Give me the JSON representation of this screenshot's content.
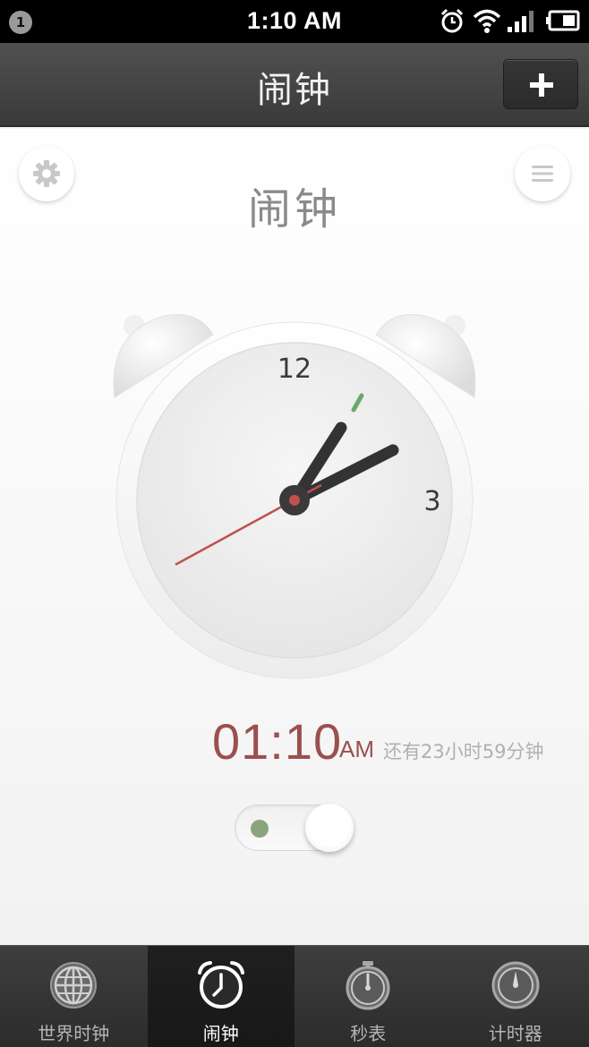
{
  "status_bar": {
    "notification_count": "1",
    "time": "1:10 AM",
    "icons": [
      "alarm-icon",
      "wifi-icon",
      "signal-icon",
      "battery-icon"
    ]
  },
  "header": {
    "title": "闹钟",
    "add_icon": "plus-icon"
  },
  "main": {
    "settings_icon": "gear-icon",
    "menu_icon": "menu-lines-icon",
    "alarm_label": "闹钟",
    "clock": {
      "numeral_12": "12",
      "numeral_3": "3"
    },
    "alarm_time": "01:10",
    "alarm_ampm": "AM",
    "remaining": "还有23小时59分钟",
    "toggle_on": true
  },
  "colors": {
    "accent_red": "#9b4f4f",
    "second_hand": "#c0504d",
    "alarm_marker": "#6aa86a",
    "toggle_dot": "#8aa57e"
  },
  "bottom_nav": {
    "items": [
      {
        "label": "世界时钟",
        "icon": "globe-icon",
        "active": false
      },
      {
        "label": "闹钟",
        "icon": "alarm-clock-icon",
        "active": true
      },
      {
        "label": "秒表",
        "icon": "stopwatch-icon",
        "active": false
      },
      {
        "label": "计时器",
        "icon": "timer-icon",
        "active": false
      }
    ]
  }
}
